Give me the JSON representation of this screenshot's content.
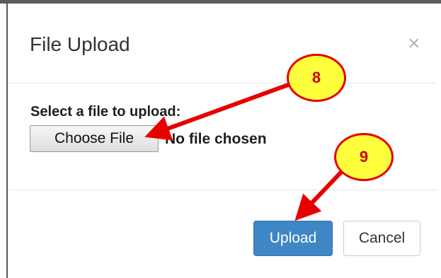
{
  "dialog": {
    "title": "File Upload",
    "close_symbol": "×"
  },
  "form": {
    "label": "Select a file to upload:",
    "choose_button": "Choose File",
    "file_status": "No file chosen"
  },
  "footer": {
    "upload_label": "Upload",
    "cancel_label": "Cancel"
  },
  "annotations": {
    "step_8": "8",
    "step_9": "9",
    "arrow_color": "#e60000",
    "badge_fill": "#ffff3d"
  },
  "colors": {
    "primary_button": "#3f86c7",
    "title_text": "#333333"
  }
}
